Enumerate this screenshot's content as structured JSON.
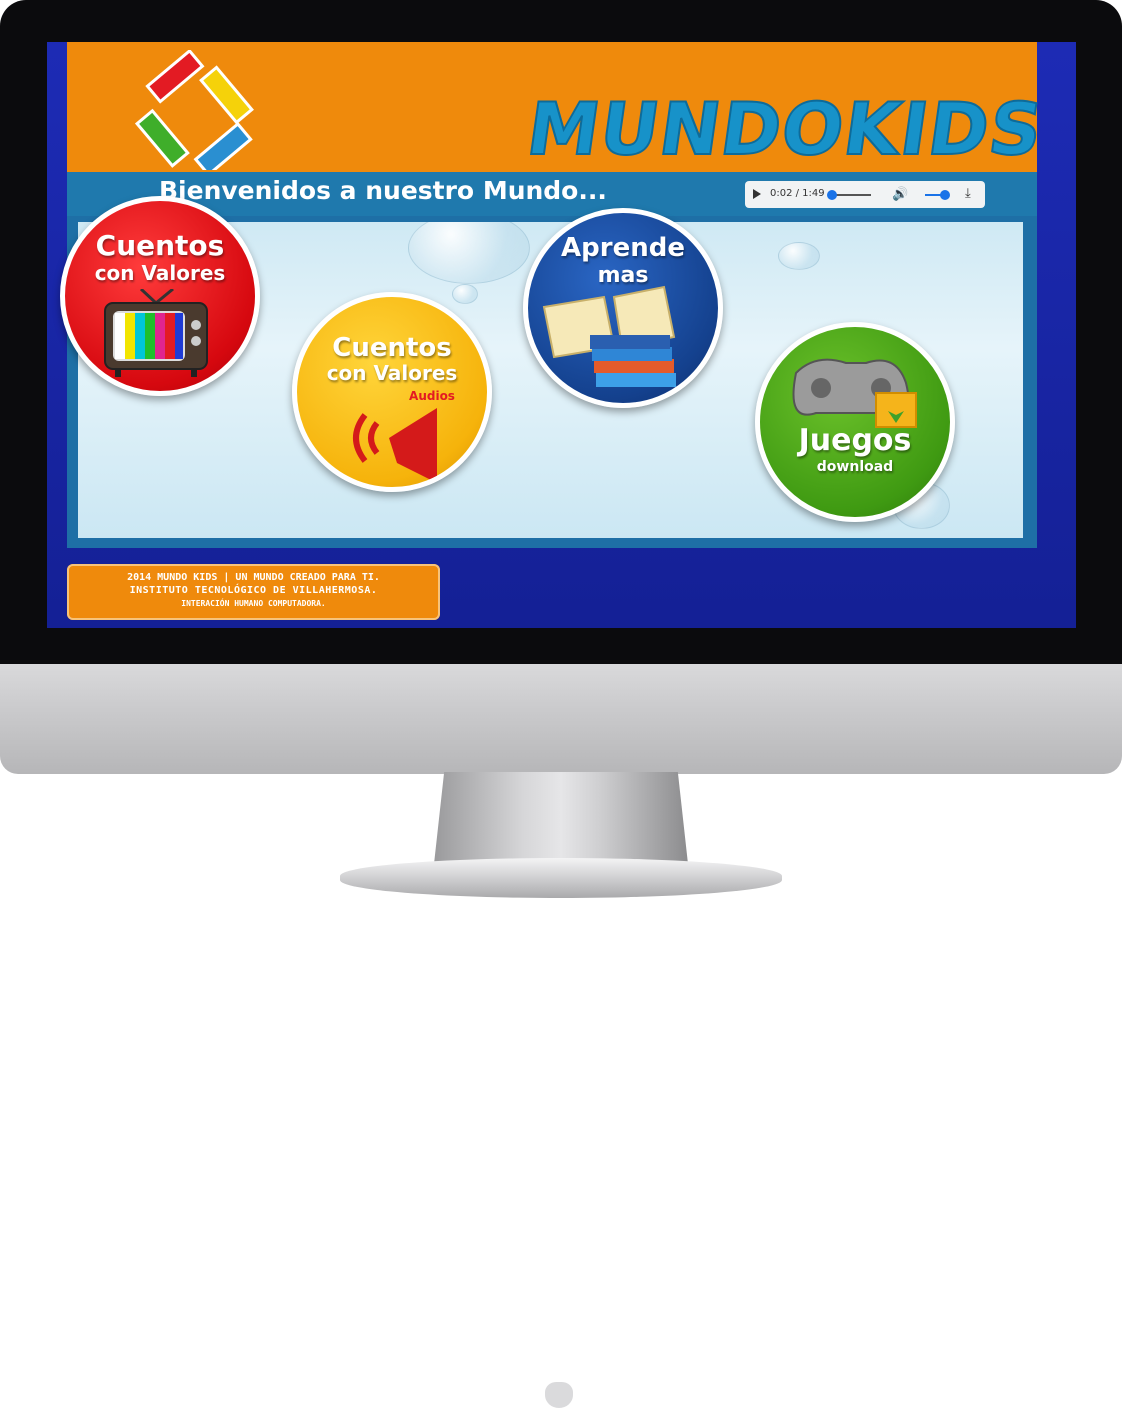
{
  "brand": {
    "name": "MUNDOKIDS"
  },
  "welcome": {
    "text": "Bienvenidos a nuestro Mundo..."
  },
  "audio": {
    "time": "0:02 / 1:49",
    "progress": 0.02
  },
  "cards": [
    {
      "line1": "Cuentos",
      "line2": "con Valores"
    },
    {
      "line1": "Cuentos",
      "line2": "con Valores",
      "line3": "Audios"
    },
    {
      "line1": "Aprende",
      "line2": "mas"
    },
    {
      "line1": "Juegos",
      "line2": "download"
    }
  ],
  "footer": {
    "line1": "2014 MUNDO KIDS | UN MUNDO CREADO PARA TI.",
    "line2": "INSTITUTO TECNOLÓGICO DE VILLAHERMOSA.",
    "line3": "INTERACIÓN HUMANO COMPUTADORA."
  },
  "colors": {
    "orange": "#ef8a0c",
    "brand_blue": "#1792c9",
    "screen_blue": "#1d2bb5",
    "red": "#d6080f",
    "yellow": "#f6b30b",
    "dark_blue": "#14418e",
    "green": "#3f9a12"
  }
}
